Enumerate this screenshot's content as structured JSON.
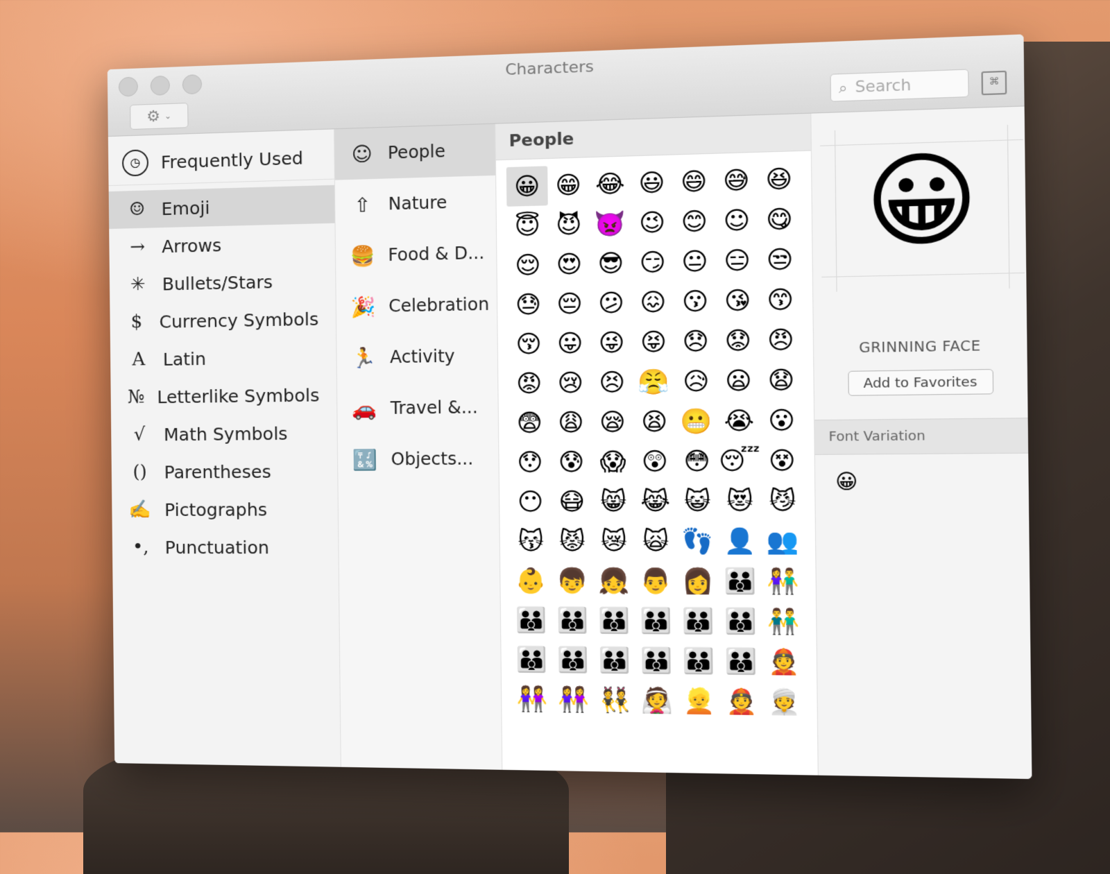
{
  "window": {
    "title": "Characters"
  },
  "toolbar": {
    "gear_icon": "⚙",
    "chevron_icon": "⌄",
    "search_placeholder": "Search",
    "keyboard_icon": "⌘"
  },
  "categories": {
    "frequently_used": {
      "icon": "◷",
      "label": "Frequently Used"
    },
    "items": [
      {
        "icon": "☺",
        "label": "Emoji",
        "selected": true
      },
      {
        "icon": "→",
        "label": "Arrows"
      },
      {
        "icon": "✳",
        "label": "Bullets/Stars"
      },
      {
        "icon": "$",
        "label": "Currency Symbols"
      },
      {
        "icon": "A",
        "label": "Latin"
      },
      {
        "icon": "№",
        "label": "Letterlike Symbols"
      },
      {
        "icon": "√",
        "label": "Math Symbols"
      },
      {
        "icon": "()",
        "label": "Parentheses"
      },
      {
        "icon": "✍",
        "label": "Pictographs"
      },
      {
        "icon": "•,",
        "label": "Punctuation"
      }
    ]
  },
  "subcategories": [
    {
      "icon": "☺",
      "label": "People",
      "selected": true
    },
    {
      "icon": "⇧",
      "label": "Nature"
    },
    {
      "icon": "🍔",
      "label": "Food & D..."
    },
    {
      "icon": "🎉",
      "label": "Celebration"
    },
    {
      "icon": "🏃",
      "label": "Activity"
    },
    {
      "icon": "🚗",
      "label": "Travel &..."
    },
    {
      "icon": "🔣",
      "label": "Objects..."
    }
  ],
  "grid": {
    "header": "People",
    "emojis": [
      "😀",
      "😁",
      "😂",
      "😃",
      "😄",
      "😅",
      "😆",
      "😇",
      "😈",
      "👿",
      "😉",
      "😊",
      "☺",
      "😋",
      "😌",
      "😍",
      "😎",
      "😏",
      "😐",
      "😑",
      "😒",
      "😓",
      "😔",
      "😕",
      "😖",
      "😗",
      "😘",
      "😙",
      "😚",
      "😛",
      "😜",
      "😝",
      "😞",
      "😟",
      "😠",
      "😡",
      "😢",
      "😣",
      "😤",
      "😥",
      "😦",
      "😧",
      "😨",
      "😩",
      "😪",
      "😫",
      "😬",
      "😭",
      "😮",
      "😯",
      "😰",
      "😱",
      "😲",
      "😳",
      "😴",
      "😵",
      "😶",
      "😷",
      "😸",
      "😹",
      "😺",
      "😻",
      "😼",
      "😽",
      "😾",
      "😿",
      "🙀",
      "👣",
      "👤",
      "👥",
      "👶",
      "👦",
      "👧",
      "👨",
      "👩",
      "👪",
      "👫",
      "👪",
      "👪",
      "👪",
      "👪",
      "👪",
      "👪",
      "👬",
      "👪",
      "👪",
      "👪",
      "👪",
      "👪",
      "👪",
      "👲",
      "👭",
      "👭",
      "👯",
      "👰",
      "👱",
      "👲",
      "👳"
    ]
  },
  "detail": {
    "preview_emoji": "😀",
    "name": "GRINNING FACE",
    "add_favorites_label": "Add to Favorites",
    "font_variation_header": "Font Variation",
    "font_variation_item": "😀"
  }
}
